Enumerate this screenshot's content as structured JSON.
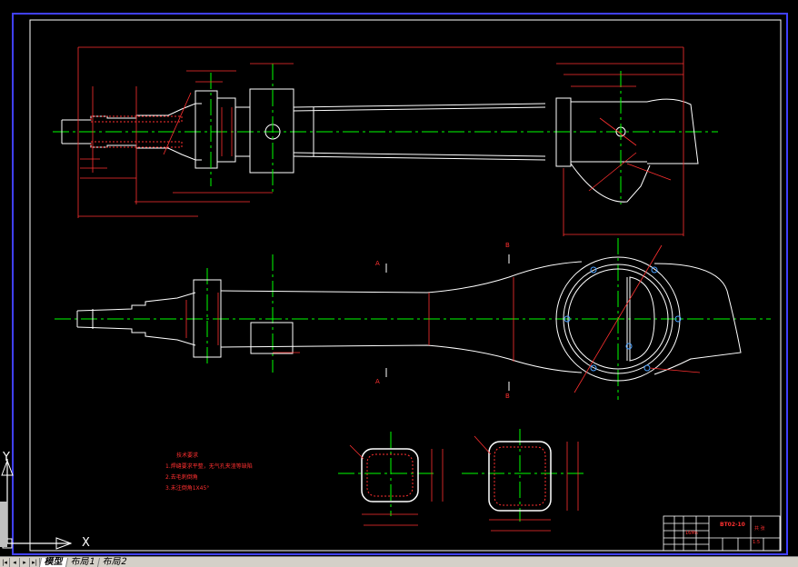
{
  "notes": {
    "title": "技术要求",
    "items": [
      "1.焊缝要求平整，无气孔夹渣等缺陷",
      "2.去毛刺倒角",
      "3.未注倒角1X45°"
    ]
  },
  "section_labels": [
    "A",
    "A",
    "B",
    "B"
  ],
  "title_block": {
    "drawing_no": "BT02-10",
    "material": "16Mn",
    "scale": "1:5",
    "sheet": "共 张"
  },
  "ucs": {
    "y_label": "Y",
    "x_label": "X"
  },
  "tabs": {
    "nav": [
      "|◂",
      "◂",
      "▸",
      "▸|"
    ],
    "items": [
      {
        "label": "模型",
        "active": true
      },
      {
        "label": "布局1",
        "active": false
      },
      {
        "label": "布局2",
        "active": false
      }
    ]
  },
  "colors": {
    "background": "#000000",
    "outline": "#ffffff",
    "centerline": "#00ff00",
    "dimension": "#ff3030",
    "frame": "#4040ff"
  }
}
